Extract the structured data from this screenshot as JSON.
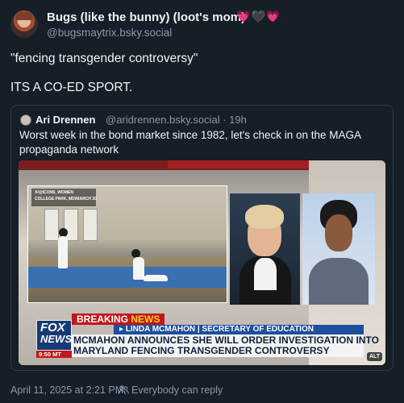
{
  "post": {
    "display_name": "Bugs (like the bunny) (loot's mom)",
    "name_emoji": [
      "💗",
      "🖤",
      "💗"
    ],
    "handle": "@bugsmaytrix.bsky.social",
    "text_line1": "\"fencing transgender controversy\"",
    "text_line2": "ITS A CO-ED SPORT.",
    "timestamp": "April 11, 2025 at 2:21 PM",
    "reply_setting": "Everybody can reply",
    "reply_icon": "people-icon"
  },
  "quote": {
    "author_name": "Ari Drennen",
    "author_handle": "@aridrennen.bsky.social · 19h",
    "text_line1": "Worst week in the bond market since 1982, let's check in on the MAGA",
    "text_line2": "propaganda network"
  },
  "media": {
    "alt_badge": "ALT",
    "fencing_tag": "X/@ICONS_WOMEN",
    "fencing_location": "COLLEGE PARK, MD/MARCH 30",
    "breaking_word1": "BREAKING",
    "breaking_word2": "NEWS",
    "subtitle": "▸ LINDA MCMAHON | SECRETARY OF EDUCATION",
    "headline_line1": "MCMAHON ANNOUNCES SHE WILL ORDER INVESTIGATION INTO",
    "headline_line2": "MARYLAND FENCING TRANSGENDER CONTROVERSY",
    "network_line1": "FOX",
    "network_line2": "NEWS",
    "clock": "9:50 MT"
  },
  "colors": {
    "background": "#161e27",
    "muted_text": "#8a99a8",
    "card_border": "#2e3b49",
    "breaking_red": "#c0181b",
    "fox_blue": "#163a74"
  }
}
